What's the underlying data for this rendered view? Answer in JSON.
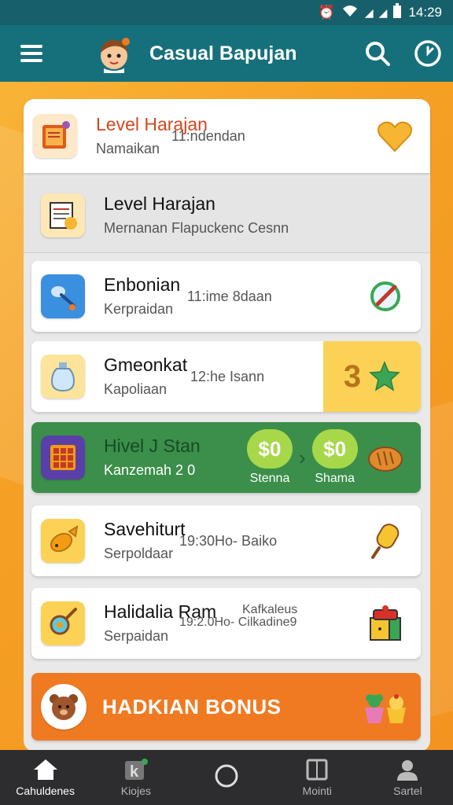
{
  "status_bar": {
    "time": "14:29"
  },
  "app_bar": {
    "title": "Casual Bapujan"
  },
  "rows": [
    {
      "title": "Level Harajan",
      "subtitle": "Namaikan",
      "extra": "11:ndendan",
      "right_icon": "heart-icon"
    },
    {
      "title": "Level Harajan",
      "subtitle": "Mernanan Flapuckenc Cesnn"
    },
    {
      "title": "Enbonian",
      "subtitle": "Kerpraidan",
      "extra": "11:ime 8daan",
      "right_icon": "no-edit-icon"
    },
    {
      "title": "Gmeonkat",
      "subtitle": "Kapoliaan",
      "extra": "12:he Isann",
      "score": "3",
      "right_icon": "star-icon"
    },
    {
      "title": "Hivel J Stan",
      "subtitle": "Kanzemah 2 0",
      "coin1": "$0",
      "coin1_label": "Stenna",
      "coin2": "$0",
      "coin2_label": "Shama",
      "right_icon": "bread-icon"
    },
    {
      "title": "Savehiturt",
      "subtitle": "Serpoldaar",
      "extra": "19:30Ho- Baiko",
      "right_icon": "popsicle-icon"
    },
    {
      "title": "Halidalia Ram",
      "subtitle": "Serpaidan",
      "extra": "19:2.0Ho- Cilkadine9",
      "extra2": "Kafkaleus",
      "right_icon": "gift-box-icon"
    },
    {
      "title": "HADKIAN BONUS",
      "right_icon": "cupcake-icon"
    }
  ],
  "bottom_nav": [
    {
      "label": "Cahuldenes",
      "icon": "home-icon"
    },
    {
      "label": "Kiojes",
      "icon": "k-app-icon"
    },
    {
      "label": "",
      "icon": "circle-icon"
    },
    {
      "label": "Mointi",
      "icon": "book-icon"
    },
    {
      "label": "Sartel",
      "icon": "person-icon"
    }
  ]
}
